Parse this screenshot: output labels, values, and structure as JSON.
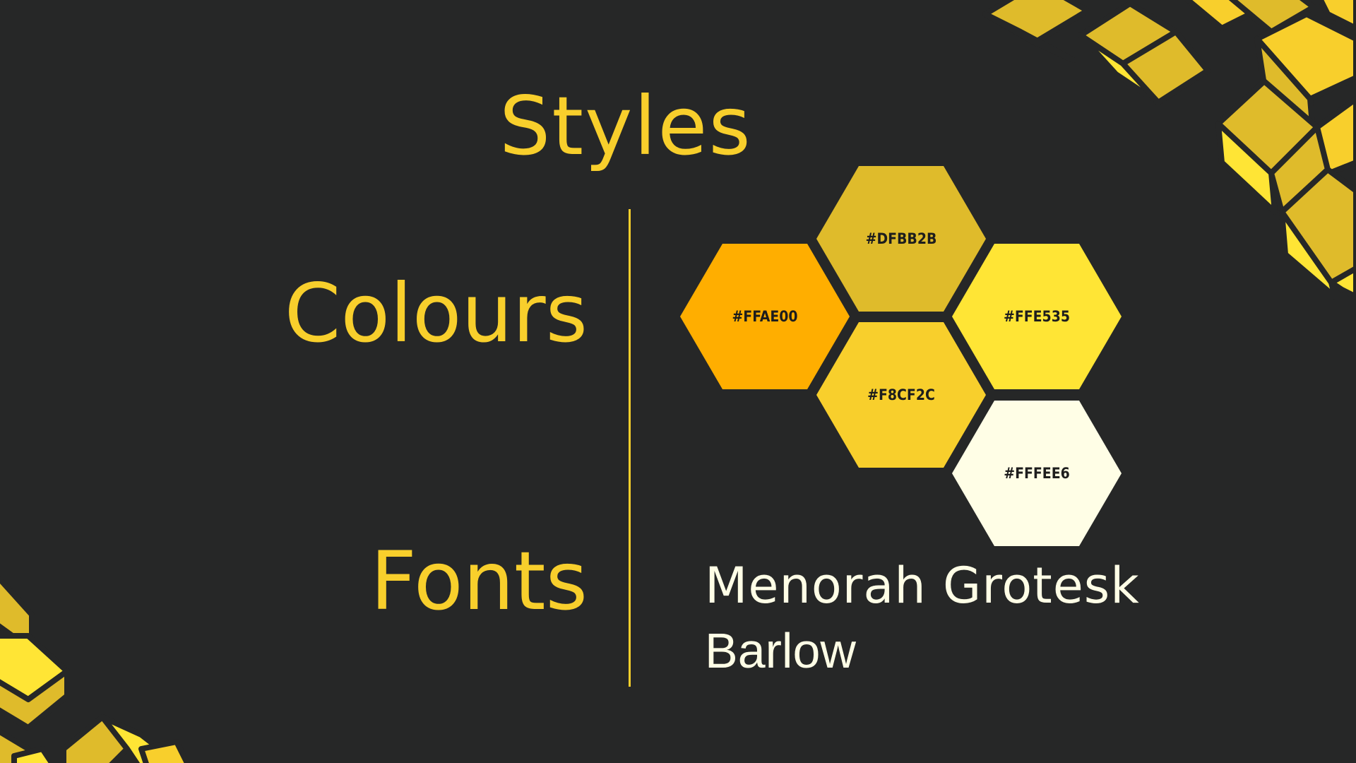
{
  "title": "Styles",
  "sections": {
    "colours_label": "Colours",
    "fonts_label": "Fonts"
  },
  "swatches": [
    {
      "label": "#DFBB2B",
      "color": "#DFBB2B"
    },
    {
      "label": "#FFAE00",
      "color": "#FFAE00"
    },
    {
      "label": "#FFE535",
      "color": "#FFE535"
    },
    {
      "label": "#F8CF2C",
      "color": "#F8CF2C"
    },
    {
      "label": "#FFFEE6",
      "color": "#FFFEE6"
    }
  ],
  "fonts": [
    "Menorah Grotesk",
    "Barlow"
  ],
  "theme": {
    "background": "#262727",
    "accent": "#F8CF2C",
    "text_light": "#FFFEE6",
    "decoration_light": "#FFE535",
    "decoration_mid": "#F8CF2C",
    "decoration_dark": "#DFBB2B"
  }
}
